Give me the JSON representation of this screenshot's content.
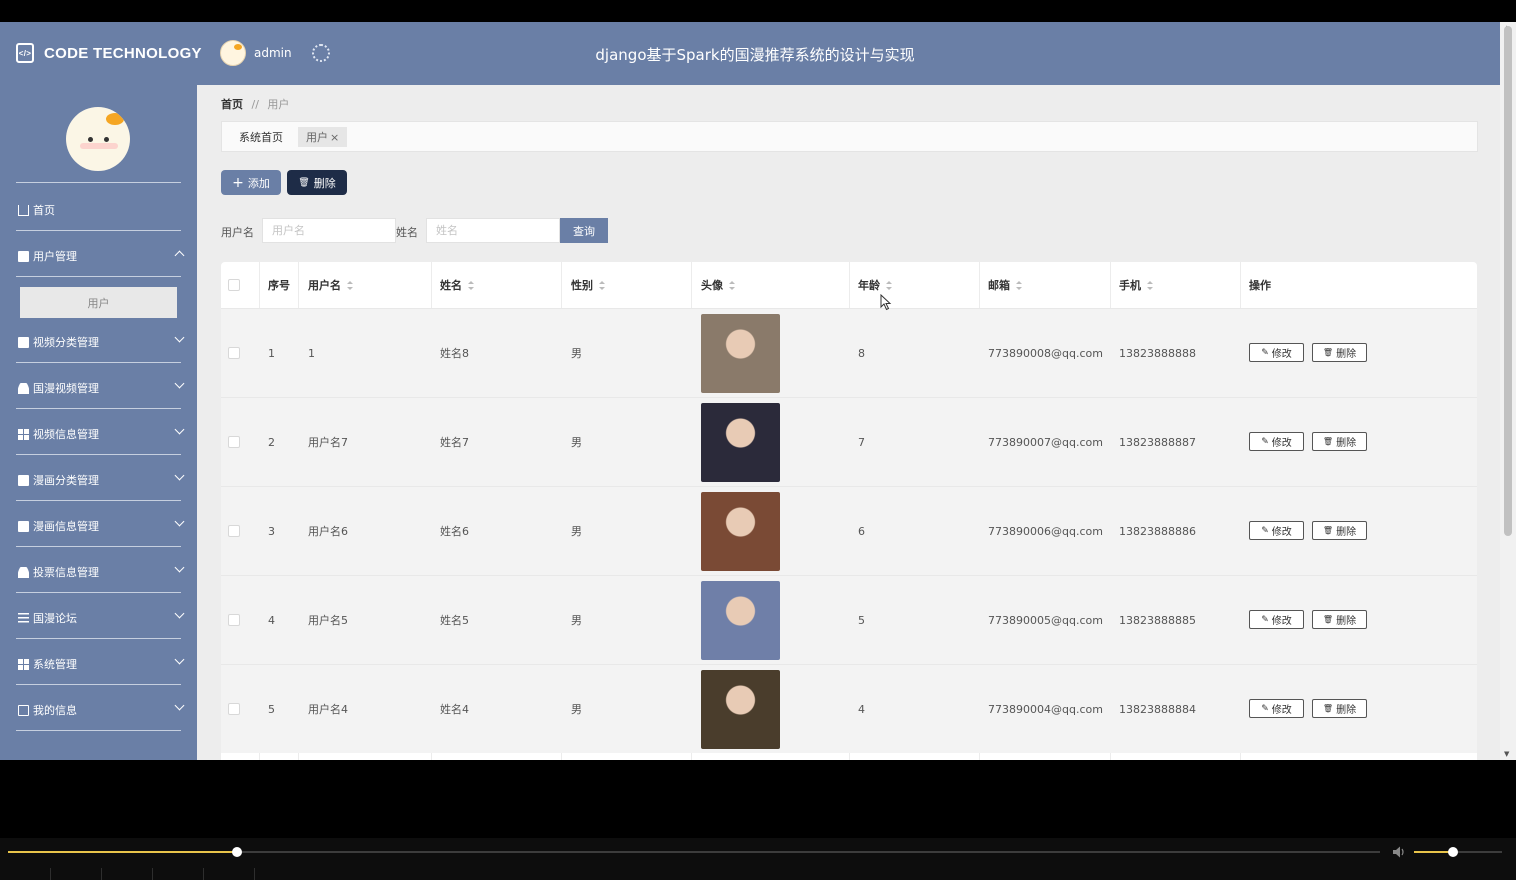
{
  "header": {
    "brand": "CODE TECHNOLOGY",
    "username": "admin",
    "title": "django基于Spark的国漫推荐系统的设计与实现"
  },
  "sidebar": {
    "items": [
      {
        "label": "首页",
        "icon": "home-icon"
      },
      {
        "label": "用户管理",
        "icon": "user-card-icon",
        "expanded": true,
        "sub": [
          "用户"
        ]
      },
      {
        "label": "视频分类管理",
        "icon": "category-icon"
      },
      {
        "label": "国漫视频管理",
        "icon": "person-icon"
      },
      {
        "label": "视频信息管理",
        "icon": "grid-icon"
      },
      {
        "label": "漫画分类管理",
        "icon": "briefcase-icon"
      },
      {
        "label": "漫画信息管理",
        "icon": "document-icon"
      },
      {
        "label": "投票信息管理",
        "icon": "person-icon"
      },
      {
        "label": "国漫论坛",
        "icon": "sliders-icon"
      },
      {
        "label": "系统管理",
        "icon": "grid-icon"
      },
      {
        "label": "我的信息",
        "icon": "card-icon"
      }
    ]
  },
  "breadcrumb": {
    "home": "首页",
    "sep": "//",
    "current": "用户"
  },
  "tabs": {
    "home": "系统首页",
    "user": "用户",
    "close": "×"
  },
  "toolbar": {
    "add": "添加",
    "delete": "删除",
    "add_icon": "+",
    "delete_icon": "🗑"
  },
  "search": {
    "username_label": "用户名",
    "username_placeholder": "用户名",
    "name_label": "姓名",
    "name_placeholder": "姓名",
    "query": "查询"
  },
  "table": {
    "columns": [
      "序号",
      "用户名",
      "姓名",
      "性别",
      "头像",
      "年龄",
      "邮箱",
      "手机",
      "操作"
    ],
    "edit_label": "修改",
    "delete_label": "删除",
    "rows": [
      {
        "index": "1",
        "username": "1",
        "name": "姓名8",
        "gender": "男",
        "age": "8",
        "email": "773890008@qq.com",
        "phone": "13823888888",
        "photo_color": "#8a7a6a"
      },
      {
        "index": "2",
        "username": "用户名7",
        "name": "姓名7",
        "gender": "男",
        "age": "7",
        "email": "773890007@qq.com",
        "phone": "13823888887",
        "photo_color": "#2b2a3a"
      },
      {
        "index": "3",
        "username": "用户名6",
        "name": "姓名6",
        "gender": "男",
        "age": "6",
        "email": "773890006@qq.com",
        "phone": "13823888886",
        "photo_color": "#7a4a35"
      },
      {
        "index": "4",
        "username": "用户名5",
        "name": "姓名5",
        "gender": "男",
        "age": "5",
        "email": "773890005@qq.com",
        "phone": "13823888885",
        "photo_color": "#6f7fa8"
      },
      {
        "index": "5",
        "username": "用户名4",
        "name": "姓名4",
        "gender": "男",
        "age": "4",
        "email": "773890004@qq.com",
        "phone": "13823888884",
        "photo_color": "#4a3d2c"
      }
    ]
  },
  "player": {
    "progress": 0.167,
    "volume": 0.44
  }
}
